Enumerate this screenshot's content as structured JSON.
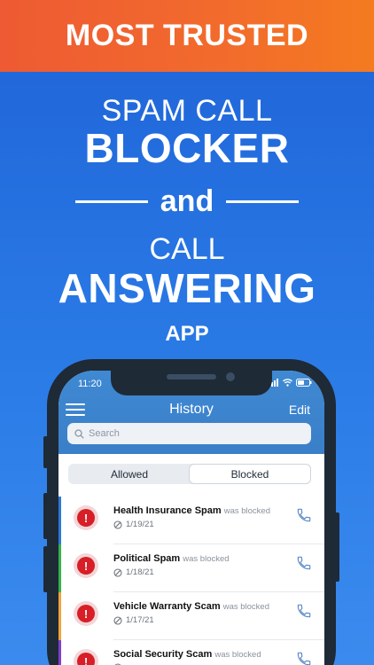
{
  "banner": {
    "text": "MOST TRUSTED"
  },
  "headline": {
    "line1": "SPAM CALL",
    "line2": "BLOCKER",
    "connector": "and",
    "line3": "CALL",
    "line4": "ANSWERING",
    "line5": "APP"
  },
  "status_bar": {
    "time": "11:20"
  },
  "app_header": {
    "title": "History",
    "edit_label": "Edit"
  },
  "search": {
    "placeholder": "Search"
  },
  "segments": [
    {
      "label": "Allowed",
      "active": false
    },
    {
      "label": "Blocked",
      "active": true
    }
  ],
  "calls": [
    {
      "name": "Health Insurance Spam",
      "suffix": "was blocked",
      "date": "1/19/21",
      "stripe_color": "#2b79d6"
    },
    {
      "name": "Political Spam",
      "suffix": "was blocked",
      "date": "1/18/21",
      "stripe_color": "#35b24a"
    },
    {
      "name": "Vehicle Warranty Scam",
      "suffix": "was blocked",
      "date": "1/17/21",
      "stripe_color": "#f2a33a"
    },
    {
      "name": "Social Security Scam",
      "suffix": "was blocked",
      "date": "",
      "stripe_color": "#7e3fcf"
    }
  ],
  "colors": {
    "banner_orange": "#f26b2c",
    "background_blue": "#2a7be6",
    "header_blue": "#3f89d3",
    "alert_red": "#d81e26",
    "phone_frame": "#1e2a36"
  },
  "icons": [
    "menu-icon",
    "search-icon",
    "block-icon",
    "phone-icon",
    "alert-icon",
    "wifi-icon",
    "battery-icon",
    "signal-icon"
  ]
}
